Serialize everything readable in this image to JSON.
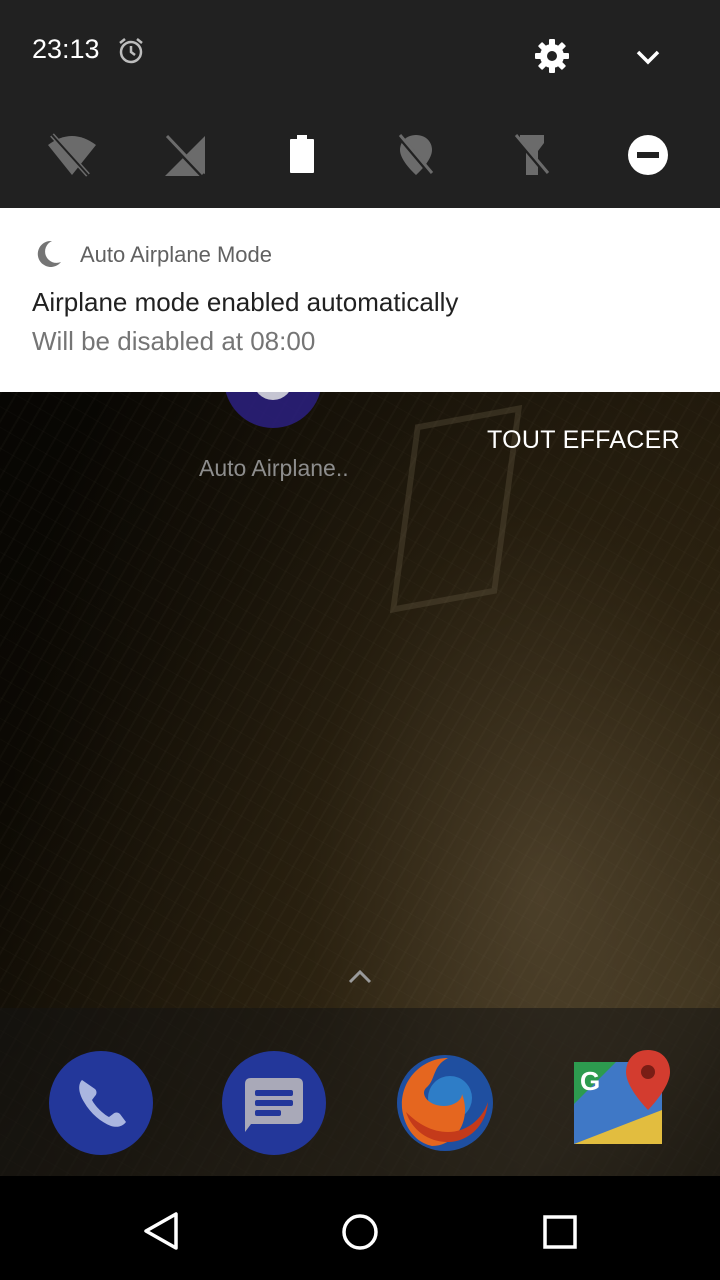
{
  "status": {
    "time": "23:13"
  },
  "icons": {
    "alarm": "alarm-clock-icon",
    "settings": "gear-icon",
    "expand": "chevron-down-icon",
    "wifi_off": "wifi-off-icon",
    "signal_off": "cellular-off-icon",
    "battery": "battery-icon",
    "location_off": "location-off-icon",
    "flashlight_off": "flashlight-off-icon",
    "dnd": "do-not-disturb-icon"
  },
  "notification": {
    "app_name": "Auto Airplane Mode",
    "title": "Airplane mode enabled automatically",
    "text": "Will be disabled at 08:00"
  },
  "home": {
    "app_label": "Auto Airplane..",
    "clear_all": "TOUT EFFACER"
  },
  "dock": [
    "Phone",
    "Messages",
    "Firefox",
    "Maps"
  ],
  "colors": {
    "shade": "#212121",
    "card": "#ffffff",
    "text_primary": "#212121",
    "text_secondary": "#757575"
  }
}
